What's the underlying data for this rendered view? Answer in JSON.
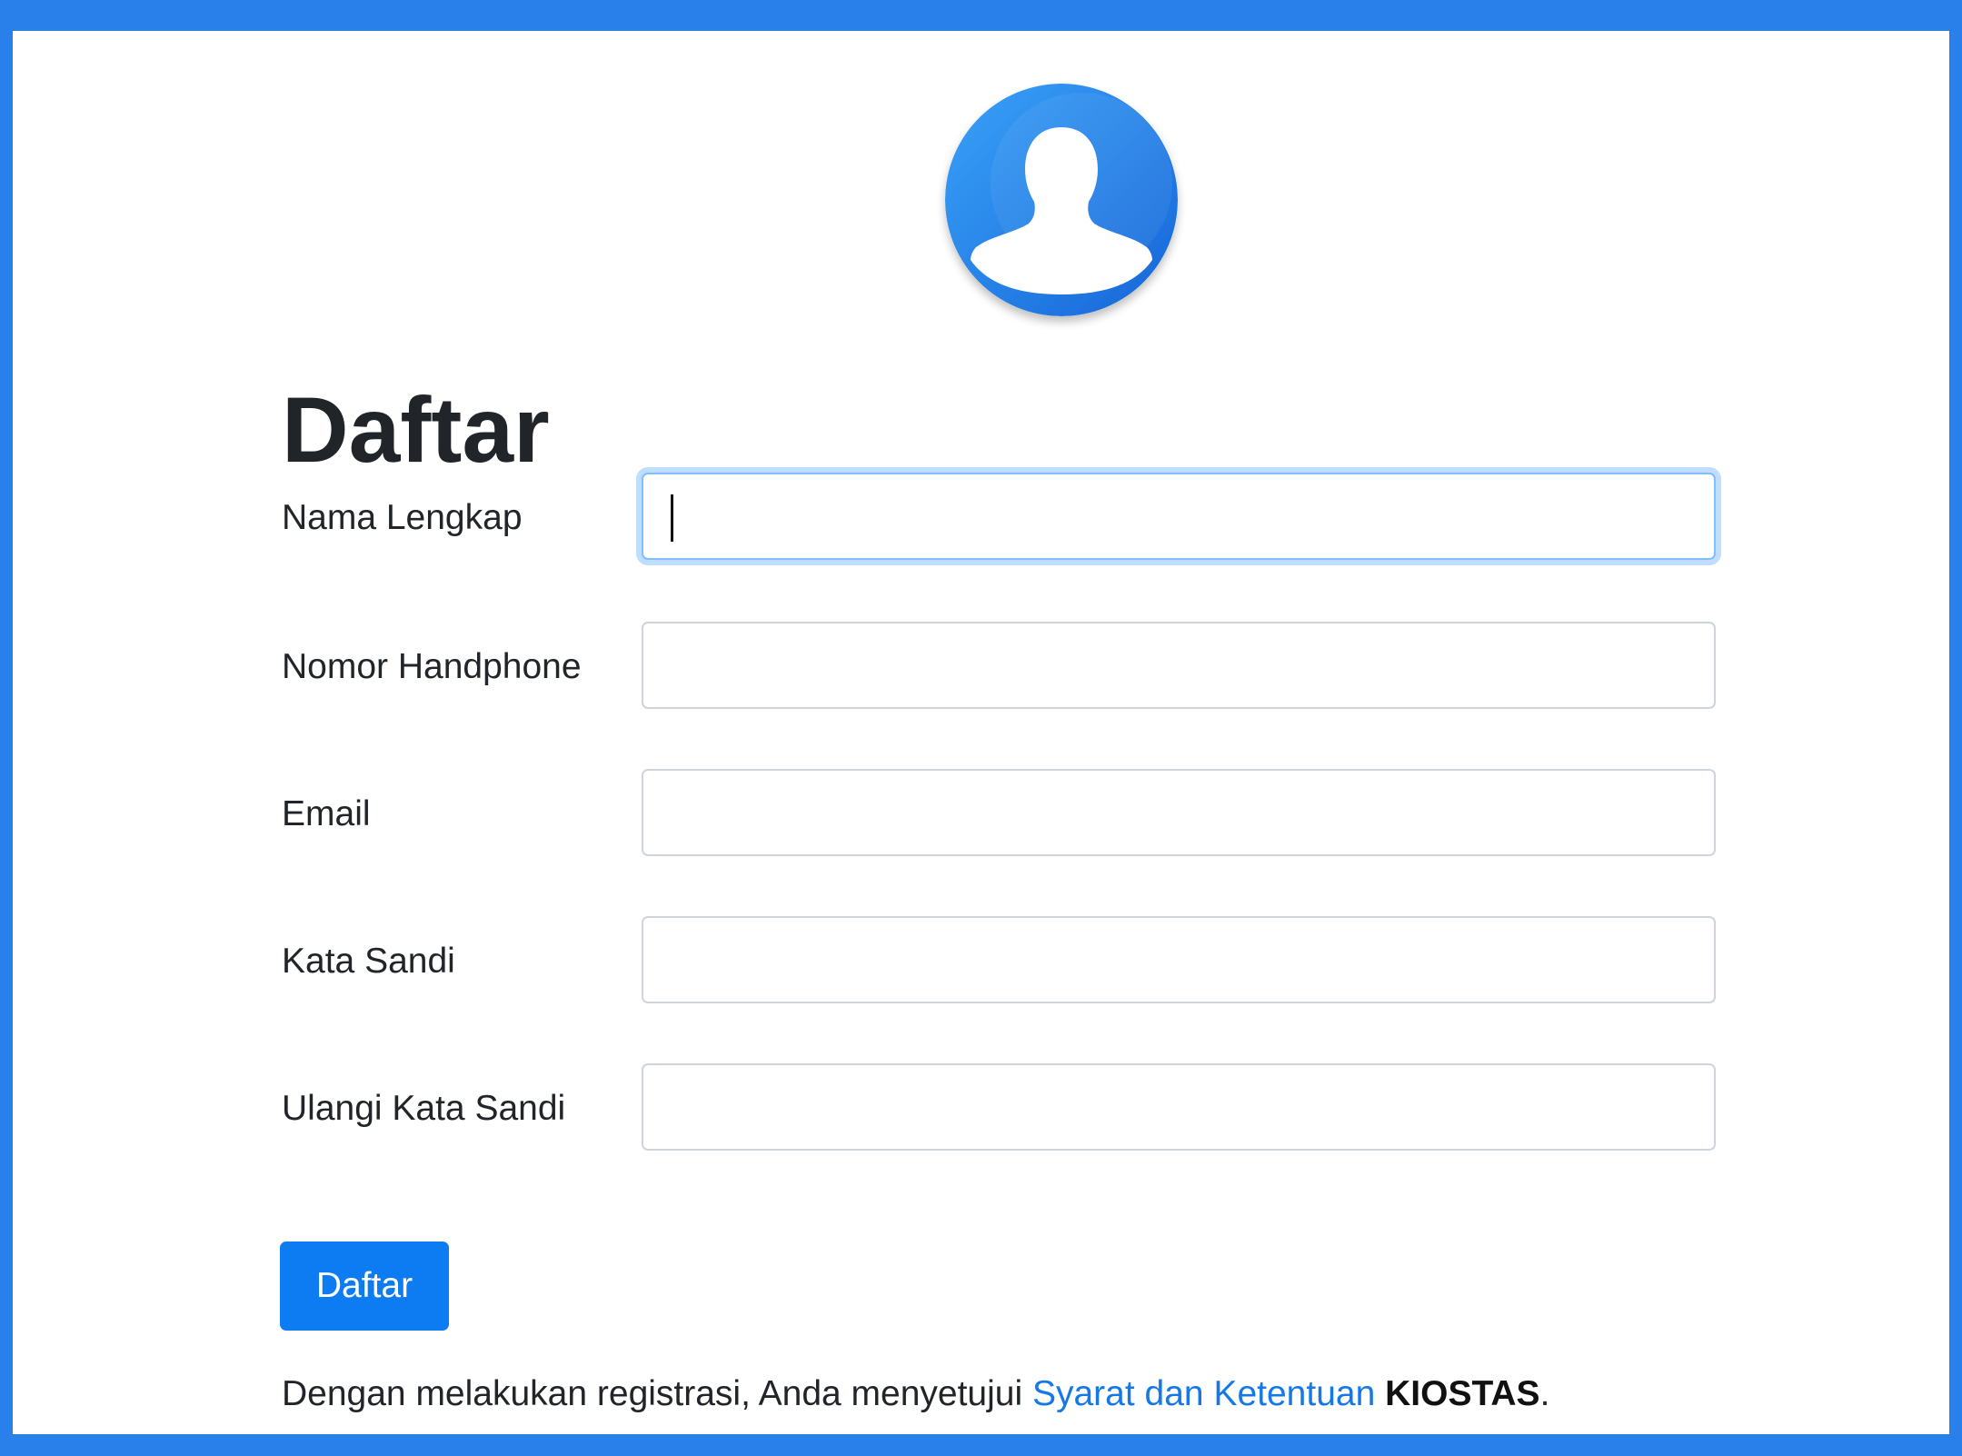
{
  "page": {
    "title": "Daftar"
  },
  "form": {
    "fields": [
      {
        "label": "Nama Lengkap",
        "value": "",
        "placeholder": "",
        "focused": true
      },
      {
        "label": "Nomor Handphone",
        "value": "",
        "placeholder": ""
      },
      {
        "label": "Email",
        "value": "",
        "placeholder": ""
      },
      {
        "label": "Kata Sandi",
        "value": "",
        "placeholder": ""
      },
      {
        "label": "Ulangi Kata Sandi",
        "value": "",
        "placeholder": ""
      }
    ],
    "submit_label": "Daftar"
  },
  "terms": {
    "prefix": "Dengan melakukan registrasi, Anda menyetujui ",
    "link": "Syarat dan Ketentuan",
    "brand": "KIOSTAS",
    "suffix": "."
  },
  "colors": {
    "frame": "#2a80ea",
    "primary": "#0d7cf2",
    "link": "#1479e6",
    "focus_border": "#80bdff"
  },
  "icons": {
    "avatar": "user-avatar-icon"
  }
}
